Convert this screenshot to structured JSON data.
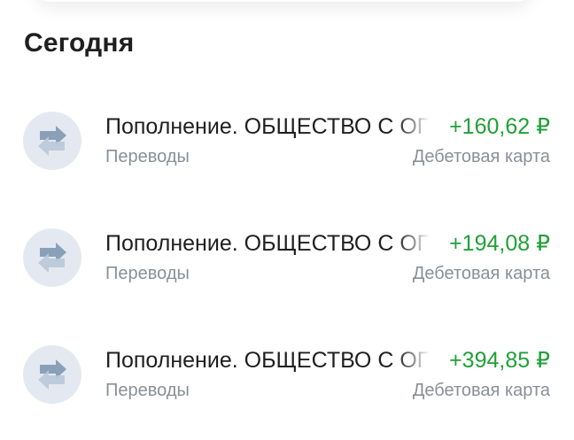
{
  "section": {
    "title": "Сегодня"
  },
  "transactions": [
    {
      "title": "Пополнение. ОБЩЕСТВО С ОГРАНИЧЕННОЙ ОТВЕТСТВЕННОСТЬЮ",
      "amount": "+160,62 ₽",
      "category": "Переводы",
      "account": "Дебетовая карта",
      "icon": "transfer-arrows-icon"
    },
    {
      "title": "Пополнение. ОБЩЕСТВО С ОГРАНИЧЕННОЙ ОТВЕТСТВЕННОСТЬЮ",
      "amount": "+194,08 ₽",
      "category": "Переводы",
      "account": "Дебетовая карта",
      "icon": "transfer-arrows-icon"
    },
    {
      "title": "Пополнение. ОБЩЕСТВО С ОГРАНИЧЕННОЙ ОТВЕТСТВЕННОСТЬЮ",
      "amount": "+394,85 ₽",
      "category": "Переводы",
      "account": "Дебетовая карта",
      "icon": "transfer-arrows-icon"
    }
  ],
  "colors": {
    "amount_positive": "#21a038",
    "secondary_text": "#8a8f97",
    "primary_text": "#1f1f1f",
    "icon_bg": "#e4e9f1",
    "icon_arrow_dark": "#8aa0b8",
    "icon_arrow_light": "#b9c8d8"
  }
}
